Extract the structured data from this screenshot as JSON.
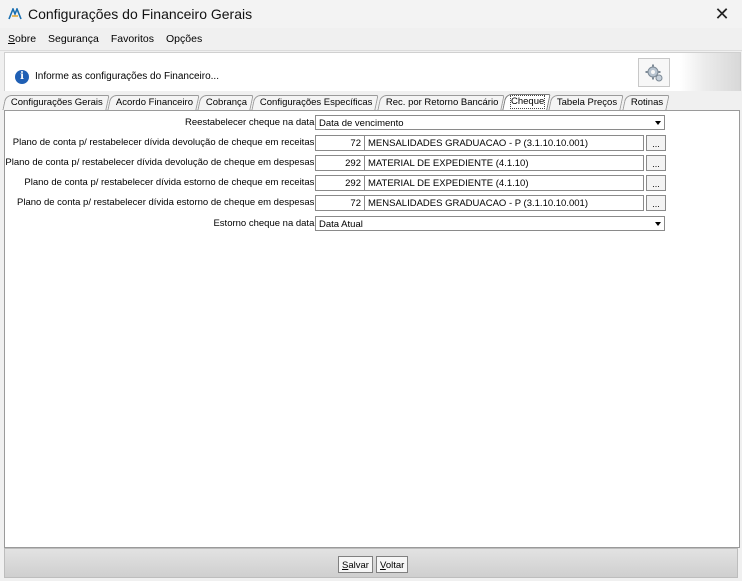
{
  "window": {
    "title": "Configurações do Financeiro Gerais",
    "close_glyph": "✕"
  },
  "menu": [
    {
      "label": "Sobre",
      "accel": "o"
    },
    {
      "label": "Segurança"
    },
    {
      "label": "Favoritos"
    },
    {
      "label": "Opções"
    }
  ],
  "info": {
    "icon": "info-icon",
    "text": "Informe as configurações do Financeiro..."
  },
  "tabs": [
    {
      "label": "Configurações Gerais",
      "active": false
    },
    {
      "label": "Acordo Financeiro",
      "active": false
    },
    {
      "label": "Cobrança",
      "active": false
    },
    {
      "label": "Configurações Específicas",
      "active": false
    },
    {
      "label": "Rec. por Retorno Bancário",
      "active": false
    },
    {
      "label": "Cheque",
      "active": true
    },
    {
      "label": "Tabela Preços",
      "active": false
    },
    {
      "label": "Rotinas",
      "active": false
    }
  ],
  "form": {
    "restabelecer_data": {
      "label": "Reestabelecer cheque na data:",
      "value": "Data de vencimento"
    },
    "plano_dev_receitas": {
      "label": "Plano de conta p/ restabelecer dívida devolução de cheque em receitas:",
      "code": "72",
      "desc": "MENSALIDADES GRADUACAO - P (3.1.10.10.001)",
      "btn": "..."
    },
    "plano_dev_despesas": {
      "label": "Plano de conta p/ restabelecer dívida devolução de cheque em despesas:",
      "code": "292",
      "desc": "MATERIAL DE EXPEDIENTE (4.1.10)",
      "btn": "..."
    },
    "plano_est_receitas": {
      "label": "Plano de conta p/ restabelecer dívida estorno de cheque em receitas:",
      "code": "292",
      "desc": "MATERIAL DE EXPEDIENTE (4.1.10)",
      "btn": "..."
    },
    "plano_est_despesas": {
      "label": "Plano de conta p/ restabelecer dívida estorno de cheque em despesas:",
      "code": "72",
      "desc": "MENSALIDADES GRADUACAO - P (3.1.10.10.001)",
      "btn": "..."
    },
    "estorno_data": {
      "label": "Estorno cheque na data:",
      "value": "Data Atual"
    }
  },
  "footer": {
    "save_label": "Salvar",
    "back_label": "Voltar"
  }
}
